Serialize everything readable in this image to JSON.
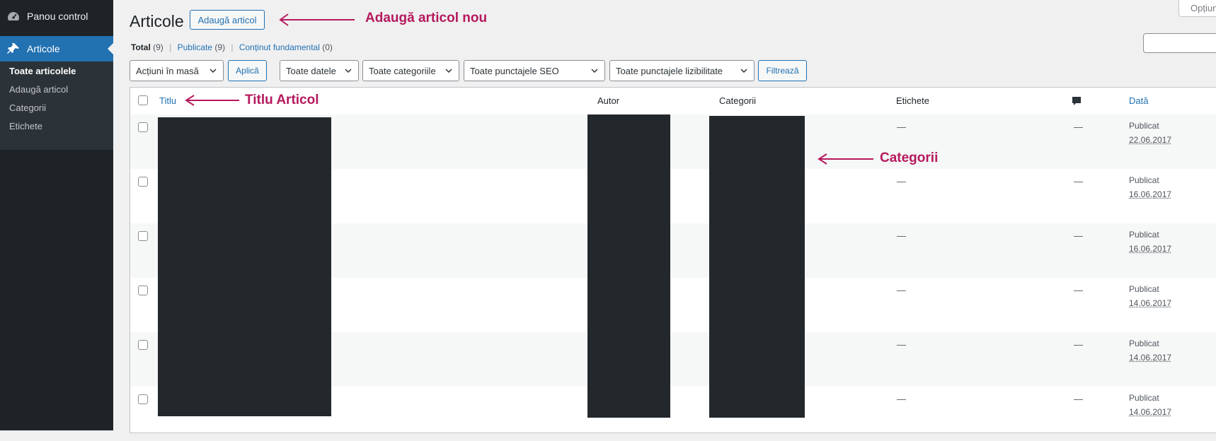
{
  "sidebar": {
    "dashboard_label": "Panou control",
    "posts_label": "Articole",
    "submenu": [
      {
        "label": "Toate articolele",
        "current": true
      },
      {
        "label": "Adaugă articol",
        "current": false
      },
      {
        "label": "Categorii",
        "current": false
      },
      {
        "label": "Etichete",
        "current": false
      }
    ]
  },
  "header": {
    "title": "Articole",
    "add_button": "Adaugă articol",
    "screen_options": "Opțiuni"
  },
  "views": {
    "total": {
      "label": "Total",
      "count": "(9)"
    },
    "published": {
      "label": "Publicate",
      "count": "(9)"
    },
    "cornerstone": {
      "label": "Conținut fundamental",
      "count": "(0)"
    },
    "separator": "|"
  },
  "filters": {
    "bulk_actions": "Acțiuni în masă",
    "apply": "Aplică",
    "all_dates": "Toate datele",
    "all_categories": "Toate categoriile",
    "all_seo": "Toate punctajele SEO",
    "all_readability": "Toate punctajele lizibilitate",
    "filter_button": "Filtrează"
  },
  "table": {
    "columns": {
      "title": "Titlu",
      "author": "Autor",
      "categories": "Categorii",
      "tags": "Etichete",
      "date": "Dată"
    },
    "rows": [
      {
        "tags": "—",
        "comments": "—",
        "status": "Publicat",
        "date": "22.06.2017"
      },
      {
        "tags": "—",
        "comments": "—",
        "status": "Publicat",
        "date": "16.06.2017"
      },
      {
        "tags": "—",
        "comments": "—",
        "status": "Publicat",
        "date": "16.06.2017"
      },
      {
        "tags": "—",
        "comments": "—",
        "status": "Publicat",
        "date": "14.06.2017"
      },
      {
        "tags": "—",
        "comments": "—",
        "status": "Publicat",
        "date": "14.06.2017"
      },
      {
        "tags": "—",
        "comments": "—",
        "status": "Publicat",
        "date": "14.06.2017"
      }
    ]
  },
  "annotations": {
    "add_new": "Adaugă articol nou",
    "title": "Titlu Articol",
    "categories": "Categorii"
  },
  "colors": {
    "accent": "#2271b1",
    "sidebar": "#1d2327",
    "annotation": "#b5195d"
  },
  "icons": [
    "dashboard-icon",
    "pin-icon",
    "comment-bubble-icon",
    "chevron-down-icon",
    "arrow-left-icon"
  ]
}
